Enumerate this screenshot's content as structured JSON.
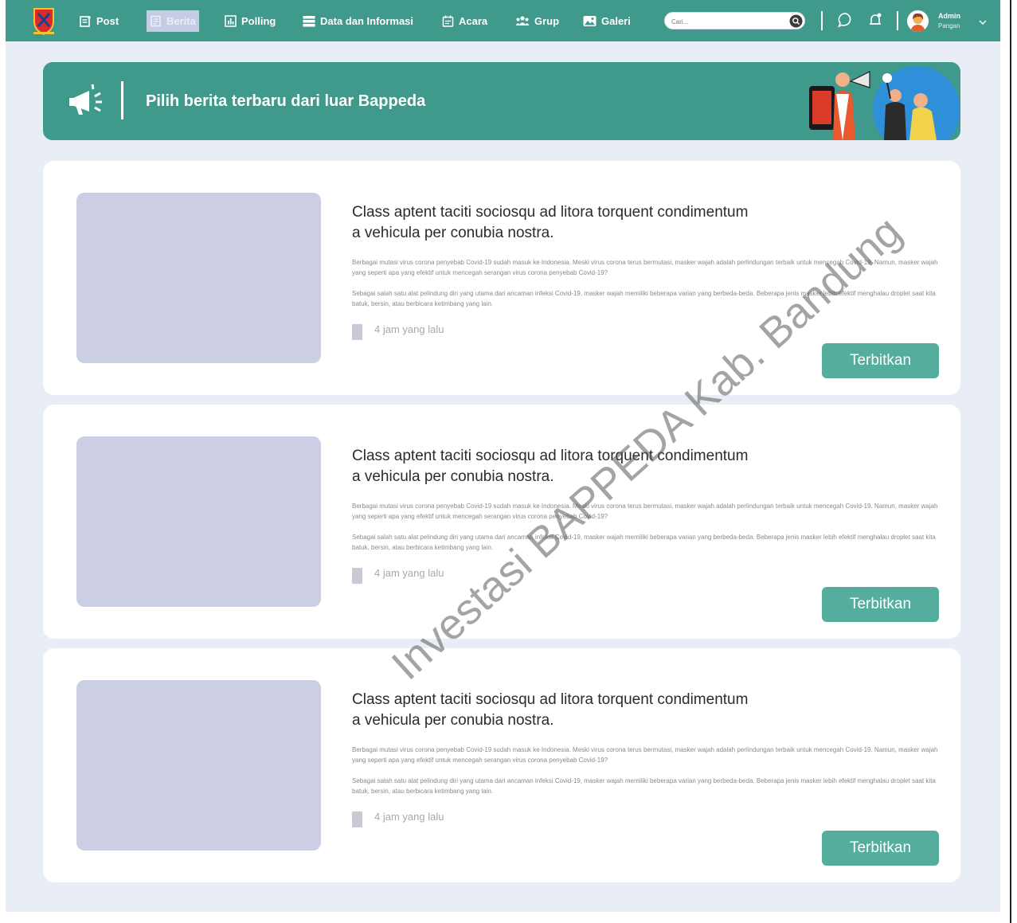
{
  "nav": {
    "items": [
      {
        "label": "Post",
        "icon": "post-icon"
      },
      {
        "label": "Berita",
        "icon": "news-icon"
      },
      {
        "label": "Polling",
        "icon": "polling-icon"
      },
      {
        "label": "Data dan Informasi",
        "icon": "database-icon"
      },
      {
        "label": "Acara",
        "icon": "calendar-icon"
      },
      {
        "label": "Grup",
        "icon": "group-icon"
      },
      {
        "label": "Galeri",
        "icon": "gallery-icon"
      }
    ],
    "active_index": 1,
    "search_placeholder": "Cari...",
    "user": {
      "name": "Admin",
      "role": "Pangan"
    }
  },
  "banner": {
    "title": "Pilih berita terbaru dari luar Bappeda"
  },
  "news": [
    {
      "title_line1": "Class aptent taciti sociosqu ad litora torquent condimentum",
      "title_line2": "a vehicula per conubia nostra.",
      "para1": "Berbagai mutasi virus corona penyebab Covid-19 sudah masuk ke Indonesia. Meski virus corona terus bermutasi, masker wajah adalah perlindungan terbaik untuk mencegah Covid-19. Namun, masker wajah yang seperti apa yang efektif untuk mencegah serangan virus corona penyebab Covid-19?",
      "para2": "Sebagai salah satu alat pelindung diri yang utama dari ancaman infeksi Covid-19, masker wajah memiliki beberapa varian yang berbeda-beda. Beberapa jenis masker lebih efektif menghalau droplet saat kita batuk, bersin, atau berbicara ketimbang yang lain.",
      "time": "4 jam yang lalu",
      "button": "Terbitkan"
    },
    {
      "title_line1": "Class aptent taciti sociosqu ad litora torquent condimentum",
      "title_line2": "a vehicula per conubia nostra.",
      "para1": "Berbagai mutasi virus corona penyebab Covid-19 sudah masuk ke Indonesia. Meski virus corona terus bermutasi, masker wajah adalah perlindungan terbaik untuk mencegah Covid-19. Namun, masker wajah yang seperti apa yang efektif untuk mencegah serangan virus corona penyebab Covid-19?",
      "para2": "Sebagai salah satu alat pelindung diri yang utama dari ancaman infeksi Covid-19, masker wajah memiliki beberapa varian yang berbeda-beda. Beberapa jenis masker lebih efektif menghalau droplet saat kita batuk, bersin, atau berbicara ketimbang yang lain.",
      "time": "4 jam yang lalu",
      "button": "Terbitkan"
    },
    {
      "title_line1": "Class aptent taciti sociosqu ad litora torquent condimentum",
      "title_line2": "a vehicula per conubia nostra.",
      "para1": "Berbagai mutasi virus corona penyebab Covid-19 sudah masuk ke Indonesia. Meski virus corona terus bermutasi, masker wajah adalah perlindungan terbaik untuk mencegah Covid-19. Namun, masker wajah yang seperti apa yang efektif untuk mencegah serangan virus corona penyebab Covid-19?",
      "para2": "Sebagai salah satu alat pelindung diri yang utama dari ancaman infeksi Covid-19, masker wajah memiliki beberapa varian yang berbeda-beda. Beberapa jenis masker lebih efektif menghalau droplet saat kita batuk, bersin, atau berbicara ketimbang yang lain.",
      "time": "4 jam yang lalu",
      "button": "Terbitkan"
    }
  ],
  "watermark": "Investasi BAPPEDA Kab. Bandung",
  "colors": {
    "primary": "#3f9a8c",
    "button": "#55ad9d",
    "background": "#e9edf6",
    "thumbnail": "#cccfe3",
    "active_tab": "#c5cde6"
  }
}
